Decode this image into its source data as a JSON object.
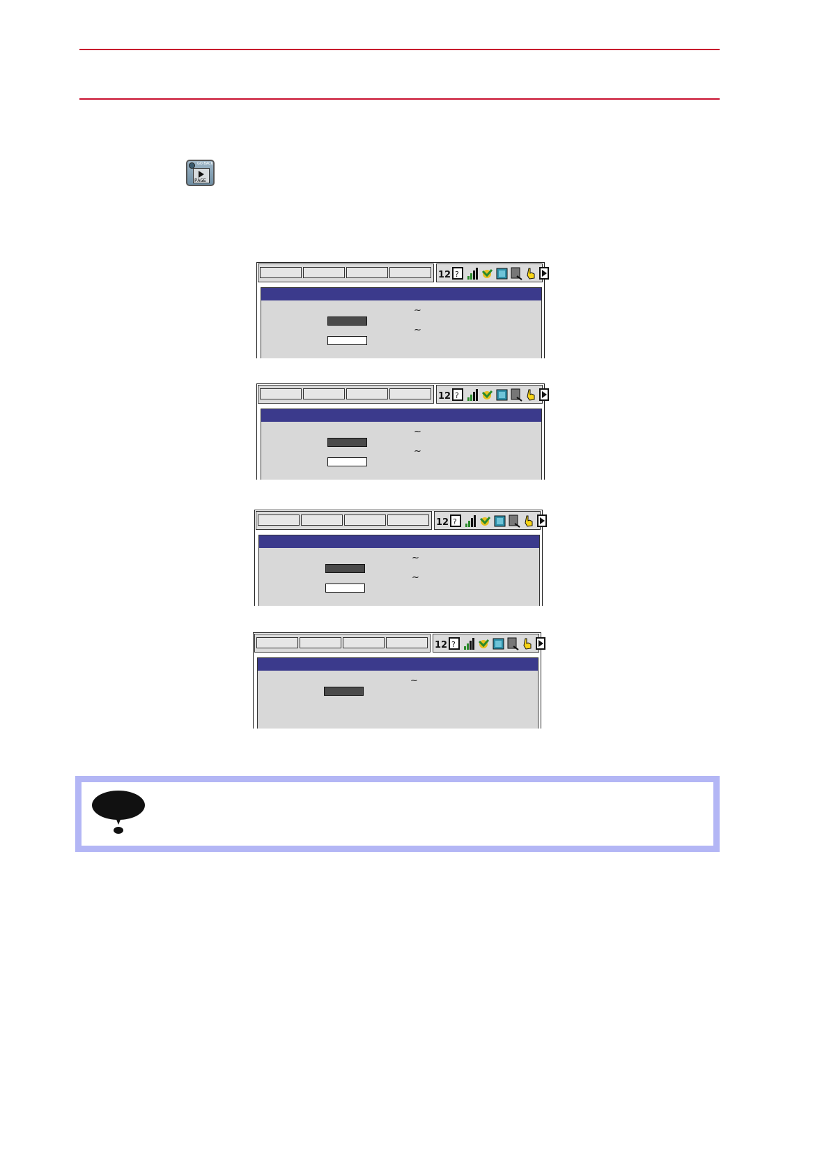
{
  "header": {
    "top_rule": "",
    "bottom_rule": ""
  },
  "page_key": {
    "label": "PAGE",
    "sub_label": "GO BACK"
  },
  "screens": [
    {
      "id": "screen-1",
      "fields": [
        "dark",
        "light"
      ],
      "tildes": 2
    },
    {
      "id": "screen-2",
      "fields": [
        "dark",
        "light"
      ],
      "tildes": 2
    },
    {
      "id": "screen-3",
      "fields": [
        "dark",
        "light"
      ],
      "tildes": 2
    },
    {
      "id": "screen-4",
      "fields": [
        "dark"
      ],
      "tildes": 1
    }
  ],
  "tilde": "~",
  "colors": {
    "rule": "#c8102e",
    "title_bar": "#3b3a8c",
    "note_border": "#b3b6f5"
  },
  "note": {
    "icon": "note-icon"
  }
}
